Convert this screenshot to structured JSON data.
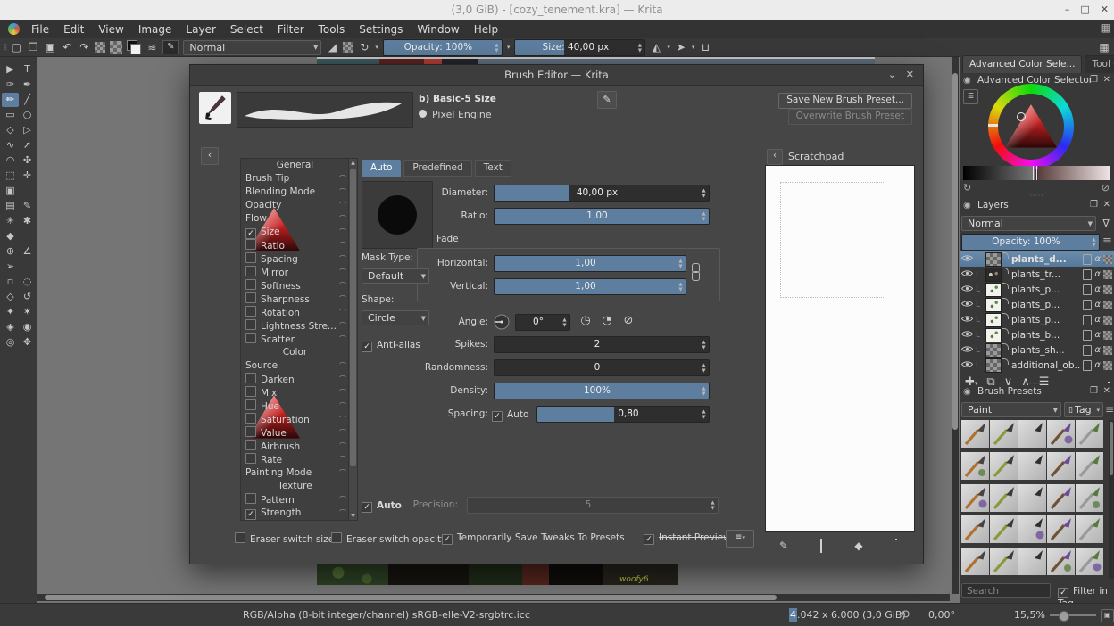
{
  "window": {
    "title": "(3,0 GiB) - [cozy_tenement.kra] — Krita",
    "minimize": "–",
    "maximize": "□",
    "close": "✕"
  },
  "menu": {
    "items": [
      "File",
      "Edit",
      "View",
      "Image",
      "Layer",
      "Select",
      "Filter",
      "Tools",
      "Settings",
      "Window",
      "Help"
    ]
  },
  "toolbar": {
    "blending_mode": "Normal",
    "opacity": "Opacity: 100%",
    "size": "Size: 40,00 px"
  },
  "toolbox": {
    "tools": [
      {
        "name": "select-shapes",
        "glyph": "▶"
      },
      {
        "name": "text",
        "glyph": "T"
      },
      {
        "name": "edit-shapes",
        "glyph": "✑"
      },
      {
        "name": "calligraphy",
        "glyph": "✒"
      },
      {
        "name": "freehand-brush",
        "glyph": "✏",
        "active": true
      },
      {
        "name": "line",
        "glyph": "╱"
      },
      {
        "name": "rectangle",
        "glyph": "▭"
      },
      {
        "name": "ellipse",
        "glyph": "○"
      },
      {
        "name": "polygon",
        "glyph": "◇"
      },
      {
        "name": "polyline",
        "glyph": "▷"
      },
      {
        "name": "bezier-curve",
        "glyph": "∿"
      },
      {
        "name": "freehand-path",
        "glyph": "➚"
      },
      {
        "name": "dynamic-brush",
        "glyph": "◠"
      },
      {
        "name": "multibrush",
        "glyph": "✣"
      },
      {
        "name": "transform",
        "glyph": "⬚"
      },
      {
        "name": "move",
        "glyph": "✛"
      },
      {
        "name": "crop",
        "glyph": "▣"
      },
      {
        "name": "",
        "glyph": ""
      },
      {
        "name": "gradient",
        "glyph": "▤"
      },
      {
        "name": "color-sampler",
        "glyph": "✎"
      },
      {
        "name": "colorize-mask",
        "glyph": "✳"
      },
      {
        "name": "smart-patch",
        "glyph": "✱"
      },
      {
        "name": "fill",
        "glyph": "◆"
      },
      {
        "name": "",
        "glyph": ""
      },
      {
        "name": "assistants",
        "glyph": "⊕"
      },
      {
        "name": "measure",
        "glyph": "∠"
      },
      {
        "name": "reference-images",
        "glyph": "➢"
      },
      {
        "name": "",
        "glyph": ""
      },
      {
        "name": "rect-select",
        "glyph": "▫"
      },
      {
        "name": "ellipse-select",
        "glyph": "◌"
      },
      {
        "name": "poly-select",
        "glyph": "◇"
      },
      {
        "name": "freehand-select",
        "glyph": "↺"
      },
      {
        "name": "contiguous-select",
        "glyph": "✦"
      },
      {
        "name": "similar-select",
        "glyph": "✶"
      },
      {
        "name": "bezier-select",
        "glyph": "◈"
      },
      {
        "name": "magnetic-select",
        "glyph": "◉"
      },
      {
        "name": "zoom",
        "glyph": "◎"
      },
      {
        "name": "pan",
        "glyph": "✥"
      }
    ]
  },
  "dialog": {
    "title": "Brush Editor — Krita",
    "preset_name": "b) Basic-5 Size",
    "engine": "Pixel Engine",
    "save_new": "Save New Brush Preset...",
    "overwrite": "Overwrite Brush Preset",
    "tabs": [
      {
        "label": "Auto",
        "active": true
      },
      {
        "label": "Predefined",
        "active": false
      },
      {
        "label": "Text",
        "active": false
      }
    ],
    "options": [
      {
        "label": "General",
        "type": "header"
      },
      {
        "label": "Brush Tip",
        "type": "plain"
      },
      {
        "label": "Blending Mode",
        "type": "plain"
      },
      {
        "label": "Opacity",
        "type": "plain"
      },
      {
        "label": "Flow",
        "type": "plain"
      },
      {
        "label": "Size",
        "type": "check",
        "checked": true
      },
      {
        "label": "Ratio",
        "type": "check",
        "checked": false
      },
      {
        "label": "Spacing",
        "type": "check",
        "checked": false
      },
      {
        "label": "Mirror",
        "type": "check",
        "checked": false
      },
      {
        "label": "Softness",
        "type": "check",
        "checked": false
      },
      {
        "label": "Sharpness",
        "type": "check",
        "checked": false
      },
      {
        "label": "Rotation",
        "type": "check",
        "checked": false
      },
      {
        "label": "Lightness Stre...",
        "type": "check",
        "checked": false
      },
      {
        "label": "Scatter",
        "type": "check",
        "checked": false
      },
      {
        "label": "Color",
        "type": "header"
      },
      {
        "label": "Source",
        "type": "plain"
      },
      {
        "label": "Darken",
        "type": "check",
        "checked": false
      },
      {
        "label": "Mix",
        "type": "check",
        "checked": false
      },
      {
        "label": "Hue",
        "type": "check",
        "checked": false
      },
      {
        "label": "Saturation",
        "type": "check",
        "checked": false
      },
      {
        "label": "Value",
        "type": "check",
        "checked": false
      },
      {
        "label": "Airbrush",
        "type": "check",
        "checked": false
      },
      {
        "label": "Rate",
        "type": "check",
        "checked": false
      },
      {
        "label": "Painting Mode",
        "type": "plain"
      },
      {
        "label": "Texture",
        "type": "header"
      },
      {
        "label": "Pattern",
        "type": "check",
        "checked": false
      },
      {
        "label": "Strength",
        "type": "check",
        "checked": true
      }
    ],
    "fields": {
      "diameter": {
        "label": "Diameter:",
        "value": "40,00 px",
        "fill": 35
      },
      "ratio": {
        "label": "Ratio:",
        "value": "1,00",
        "fill": 100
      },
      "fade": "Fade",
      "mask_type": {
        "label": "Mask Type:",
        "value": "Default"
      },
      "shape": {
        "label": "Shape:",
        "value": "Circle"
      },
      "antialias": "Anti-alias",
      "horizontal": {
        "label": "Horizontal:",
        "value": "1,00",
        "fill": 100
      },
      "vertical": {
        "label": "Vertical:",
        "value": "1,00",
        "fill": 100
      },
      "angle": {
        "label": "Angle:",
        "value": "0°"
      },
      "spikes": {
        "label": "Spikes:",
        "value": "2",
        "fill": 0
      },
      "randomness": {
        "label": "Randomness:",
        "value": "0",
        "fill": 0
      },
      "density": {
        "label": "Density:",
        "value": "100%",
        "fill": 100
      },
      "spacing": {
        "label": "Spacing:",
        "auto": "Auto",
        "value": "0,80",
        "fill": 45
      },
      "auto": "Auto",
      "precision": {
        "label": "Precision:",
        "value": "5"
      }
    },
    "footer": {
      "eraser_switch_size": "Eraser switch size",
      "eraser_switch_opacity": "Eraser switch opacity",
      "save_tweaks": "Temporarily Save Tweaks To Presets",
      "instant_preview": "Instant Preview"
    },
    "scratchpad": {
      "title": "Scratchpad"
    }
  },
  "dockers": {
    "tabs": [
      {
        "label": "Advanced Color Sele...",
        "active": true
      },
      {
        "label": "Tool Opt...",
        "active": false
      }
    ],
    "color_selector": {
      "title": "Advanced Color Selector"
    },
    "layers": {
      "title": "Layers",
      "blending": "Normal",
      "opacity": "Opacity: 100%",
      "rows": [
        {
          "name": "plants_d...",
          "selected": true,
          "thumb": "checker"
        },
        {
          "name": "plants_tr...",
          "selected": false,
          "thumb": "dark"
        },
        {
          "name": "plants_p...",
          "selected": false,
          "thumb": "light"
        },
        {
          "name": "plants_p...",
          "selected": false,
          "thumb": "light"
        },
        {
          "name": "plants_p...",
          "selected": false,
          "thumb": "light"
        },
        {
          "name": "plants_b...",
          "selected": false,
          "thumb": "light"
        },
        {
          "name": "plants_sh...",
          "selected": false,
          "thumb": "checker"
        },
        {
          "name": "additional_ob...",
          "selected": false,
          "thumb": "checker"
        }
      ]
    },
    "brush_presets": {
      "title": "Brush Presets",
      "filter": "Paint",
      "tag": "Tag",
      "search_placeholder": "Search",
      "filter_in_tag": "Filter in Tag",
      "grid_count": 25
    }
  },
  "statusbar": {
    "profile": "RGB/Alpha (8-bit integer/channel)  sRGB-elle-V2-srgbtrc.icc",
    "dims_sel": "4",
    "dims_rest": ".042 x 6.000 (3,0 GiB)",
    "rotation": "0,00°",
    "zoom": "15,5%"
  },
  "canvas": {
    "signature": "woofy6"
  },
  "colors": {
    "accent": "#5d7e9e",
    "selection": "#5d7e9e"
  }
}
